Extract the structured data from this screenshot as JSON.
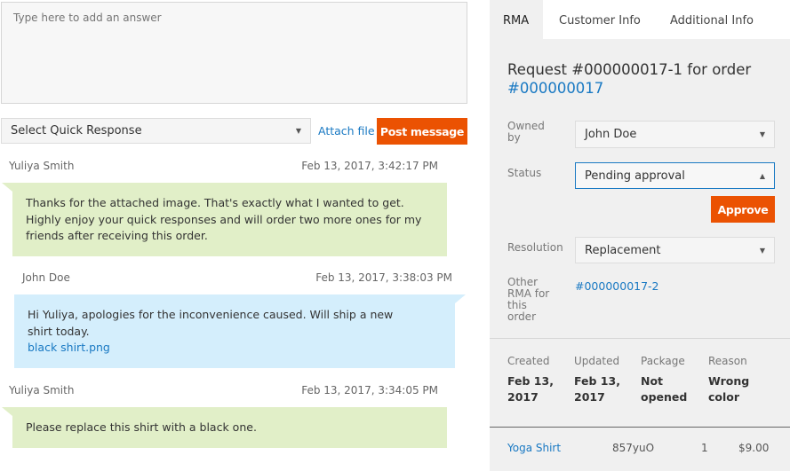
{
  "composer": {
    "placeholder": "Type here to add an answer",
    "quick_response": "Select Quick Response",
    "attach_label": "Attach file",
    "post_label": "Post message"
  },
  "messages": [
    {
      "author": "Yuliya Smith",
      "time": "Feb 13, 2017, 3:42:17 PM",
      "text": "Thanks for the attached image. That's exactly what I wanted to get. Highly enjoy your quick responses and will order two more ones for my friends after receiving this order."
    },
    {
      "author": "John Doe",
      "time": "Feb 13, 2017, 3:38:03 PM",
      "text": "Hi Yuliya, apologies for the inconvenience caused. Will ship a new shirt today.",
      "attachment": "black shirt.png"
    },
    {
      "author": "Yuliya Smith",
      "time": "Feb 13, 2017, 3:34:05 PM",
      "text": "Please replace this shirt with a black one."
    }
  ],
  "tabs": [
    "RMA",
    "Customer Info",
    "Additional Info"
  ],
  "rma": {
    "title": "Request #000000017-1 for order",
    "order_link": "#000000017",
    "owned_by_label": "Owned by",
    "owned_by": "John Doe",
    "status_label": "Status",
    "status": "Pending approval",
    "approve_label": "Approve",
    "resolution_label": "Resolution",
    "resolution": "Replacement",
    "other_label": "Other RMA for this order",
    "other_link": "#000000017-2",
    "info": [
      {
        "label": "Created",
        "value": "Feb 13, 2017"
      },
      {
        "label": "Updated",
        "value": "Feb 13, 2017"
      },
      {
        "label": "Package",
        "value": "Not opened"
      },
      {
        "label": "Reason",
        "value": "Wrong color"
      }
    ],
    "item": {
      "name": "Yoga Shirt",
      "sku": "857yuO",
      "qty": "1",
      "price": "$9.00"
    }
  },
  "colors": {
    "accent": "#eb5202",
    "link": "#1979c3",
    "customer_bubble": "#e1efc8",
    "staff_bubble": "#d4eefc"
  }
}
